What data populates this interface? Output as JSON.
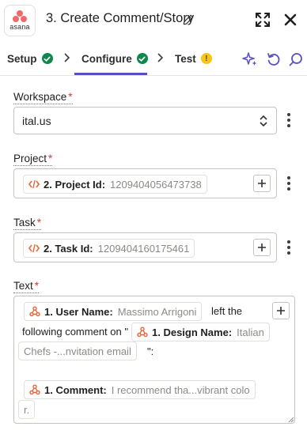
{
  "header": {
    "app_logo_text": "asana",
    "title": "3. Create Comment/Story"
  },
  "tabs": [
    {
      "label": "Setup",
      "status": "complete"
    },
    {
      "label": "Configure",
      "status": "complete"
    },
    {
      "label": "Test",
      "status": "warning",
      "status_glyph": "!"
    }
  ],
  "fields": {
    "workspace": {
      "label": "Workspace",
      "required_mark": "*",
      "value": "ital.us"
    },
    "project": {
      "label": "Project",
      "required_mark": "*",
      "pill": {
        "label": "2. Project Id:",
        "value": "1209404056473738"
      }
    },
    "task": {
      "label": "Task",
      "required_mark": "*",
      "pill": {
        "label": "2. Task Id:",
        "value": "1209404160175461"
      }
    },
    "text": {
      "label": "Text",
      "required_mark": "*",
      "pill_user": {
        "label": "1. User Name:",
        "value": "Massimo Arrigoni"
      },
      "static_1a": "left the",
      "static_1b": "following comment on \"",
      "pill_design": {
        "label": "1. Design Name:",
        "value": "Italian",
        "value_cont": "Chefs -...nvitation email"
      },
      "static_2": "\":",
      "pill_comment": {
        "label": "1. Comment:",
        "value": "I recommend tha...vibrant colo",
        "value_cont": "r."
      }
    }
  },
  "icons": {
    "app": "asana-logo",
    "edit": "pencil-icon",
    "expand": "expand-icon",
    "close": "close-icon",
    "ai": "sparkle-icon",
    "refresh": "refresh-icon",
    "search": "search-icon"
  },
  "colors": {
    "accent": "#5850c5",
    "success": "#0f884e",
    "warning": "#f5c518",
    "required": "#e0372c",
    "asana": "#f06a6a",
    "webhook": "#e8663a",
    "code": "#e8663a"
  }
}
